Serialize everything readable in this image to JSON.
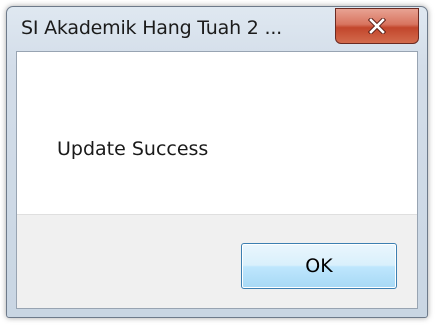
{
  "window": {
    "title": "SI Akademik Hang Tuah 2 ...",
    "close_icon": "close-icon"
  },
  "message": {
    "text": "Update Success"
  },
  "buttons": {
    "ok_label": "OK"
  },
  "colors": {
    "frame": "#d3dde9",
    "close_button": "#c2462c",
    "ok_button": "#bee6fd",
    "ok_border": "#3c7fb1",
    "button_area": "#f0f0f0"
  }
}
